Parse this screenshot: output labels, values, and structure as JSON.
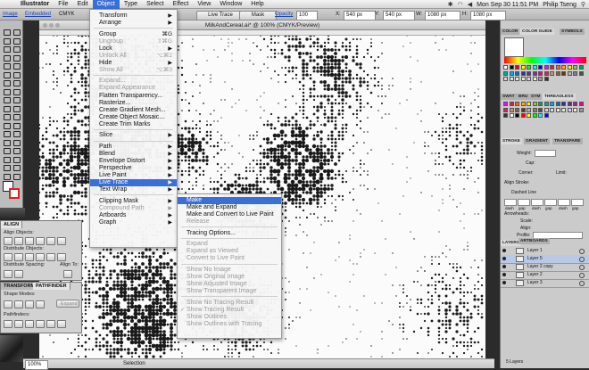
{
  "menubar": {
    "app": "Illustrator",
    "items": [
      "File",
      "Edit",
      "Object",
      "Type",
      "Select",
      "Effect",
      "View",
      "Window",
      "Help"
    ],
    "active": "Object",
    "clock": "Mon Sep 30  11:51 PM",
    "user": "Philip Tseng"
  },
  "controlbar": {
    "type": "Image",
    "embedded": "Embedded",
    "mode": "CMYK",
    "live_trace": "Live Trace",
    "mask": "Mask",
    "opacity_label": "Opacity",
    "opacity_value": "100",
    "x_label": "X:",
    "x_value": "540 px",
    "y_label": "Y:",
    "y_value": "540 px",
    "w_label": "W:",
    "w_value": "1080 px",
    "h_label": "H:",
    "h_value": "1080 px"
  },
  "document": {
    "title": "MilkAndCereal.ai* @ 100% (CMYK/Preview)",
    "zoom": "100%",
    "status": "Selection"
  },
  "object_menu": [
    {
      "label": "Transform",
      "arrow": true
    },
    {
      "label": "Arrange",
      "arrow": true
    },
    {
      "sep": true
    },
    {
      "label": "Group",
      "shortcut": "⌘G"
    },
    {
      "label": "Ungroup",
      "shortcut": "⇧⌘G",
      "disabled": true
    },
    {
      "label": "Lock",
      "arrow": true
    },
    {
      "label": "Unlock All",
      "shortcut": "⌥⌘2",
      "disabled": true
    },
    {
      "label": "Hide",
      "arrow": true
    },
    {
      "label": "Show All",
      "shortcut": "⌥⌘3",
      "disabled": true
    },
    {
      "sep": true
    },
    {
      "label": "Expand...",
      "disabled": true
    },
    {
      "label": "Expand Appearance",
      "disabled": true
    },
    {
      "label": "Flatten Transparency..."
    },
    {
      "label": "Rasterize..."
    },
    {
      "label": "Create Gradient Mesh..."
    },
    {
      "label": "Create Object Mosaic..."
    },
    {
      "label": "Create Trim Marks"
    },
    {
      "sep": true
    },
    {
      "label": "Slice",
      "arrow": true
    },
    {
      "sep": true
    },
    {
      "label": "Path",
      "arrow": true
    },
    {
      "label": "Blend",
      "arrow": true
    },
    {
      "label": "Envelope Distort",
      "arrow": true
    },
    {
      "label": "Perspective",
      "arrow": true
    },
    {
      "label": "Live Paint",
      "arrow": true
    },
    {
      "label": "Live Trace",
      "arrow": true,
      "highlight": true
    },
    {
      "label": "Text Wrap",
      "arrow": true
    },
    {
      "sep": true
    },
    {
      "label": "Clipping Mask",
      "arrow": true
    },
    {
      "label": "Compound Path",
      "arrow": true,
      "disabled": true
    },
    {
      "label": "Artboards",
      "arrow": true
    },
    {
      "label": "Graph",
      "arrow": true
    }
  ],
  "live_trace_menu": [
    {
      "label": "Make",
      "highlight": true
    },
    {
      "label": "Make and Expand"
    },
    {
      "label": "Make and Convert to Live Paint"
    },
    {
      "label": "Release",
      "disabled": true
    },
    {
      "sep": true
    },
    {
      "label": "Tracing Options..."
    },
    {
      "sep": true
    },
    {
      "label": "Expand",
      "disabled": true
    },
    {
      "label": "Expand as Viewed",
      "disabled": true
    },
    {
      "label": "Convert to Live Paint",
      "disabled": true
    },
    {
      "sep": true
    },
    {
      "label": "Show No Image",
      "disabled": true
    },
    {
      "label": "Show Original Image",
      "disabled": true
    },
    {
      "label": "Show Adjusted Image",
      "disabled": true
    },
    {
      "label": "Show Transparent Image",
      "disabled": true
    },
    {
      "sep": true
    },
    {
      "label": "Show No Tracing Result",
      "disabled": true
    },
    {
      "label": "Show Tracing Result",
      "disabled": true,
      "checked": true
    },
    {
      "label": "Show Outlines",
      "disabled": true
    },
    {
      "label": "Show Outlines with Tracing",
      "disabled": true
    }
  ],
  "align_panel": {
    "title": "ALIGN",
    "align_objects": "Align Objects:",
    "distribute_objects": "Distribute Objects:",
    "distribute_spacing": "Distribute Spacing:",
    "align_to": "Align To:"
  },
  "pathfinder_panel": {
    "tab1": "TRANSFORM",
    "tab2": "PATHFINDER",
    "shape_modes": "Shape Modes:",
    "expand": "Expand",
    "pathfinders": "Pathfinders:"
  },
  "right_panels": {
    "color_tabs": [
      "COLOR",
      "COLOR GUIDE",
      "SYMBOLS"
    ],
    "swatch_tabs": [
      "SWAT",
      "BRU",
      "SYM",
      "THREADLESS"
    ],
    "stroke_tabs": [
      "STROKE",
      "GRADIENT",
      "TRANSPARE"
    ],
    "stroke_labels": {
      "weight": "Weight:",
      "cap": "Cap:",
      "corner": "Corner:",
      "limit": "Limit:",
      "align_stroke": "Align Stroke:",
      "dashed": "Dashed Line",
      "dash_cells": [
        "dash",
        "gap",
        "dash",
        "gap",
        "dash",
        "gap"
      ],
      "arrowheads": "Arrowheads:",
      "scale": "Scale:",
      "align": "Align:",
      "profile": "Profile:"
    },
    "layers_tabs": [
      "LAYERS",
      "ARTBOARDS"
    ],
    "layers": [
      "Layer 1",
      "Layer 5",
      "Layer 2 copy",
      "Layer 2",
      "Layer 3"
    ],
    "layers_count": "5 Layers"
  },
  "colors": {
    "menu_highlight": "#3b6fd8",
    "swatches": [
      "#ffffff",
      "#000000",
      "#ff0000",
      "#ffff00",
      "#00ff00",
      "#00ffff",
      "#0000ff",
      "#ff00ff",
      "#e11d2b",
      "#f26b1d",
      "#f7a81b",
      "#fff200",
      "#8dc63f",
      "#00a651",
      "#00a99d",
      "#00aeef",
      "#0072bc",
      "#2e3192",
      "#662d91",
      "#92278f",
      "#ec008c",
      "#ed145b",
      "#c69c6d",
      "#8c6239",
      "#603813",
      "#b3b3b3",
      "#808080",
      "#4d4d4d",
      "#f5c7c7",
      "#c7e4f5",
      "#ffe5b4",
      "#d4f5c7",
      "#e0c7f5",
      "#f5f0c7",
      "#999999",
      "#333333"
    ]
  }
}
